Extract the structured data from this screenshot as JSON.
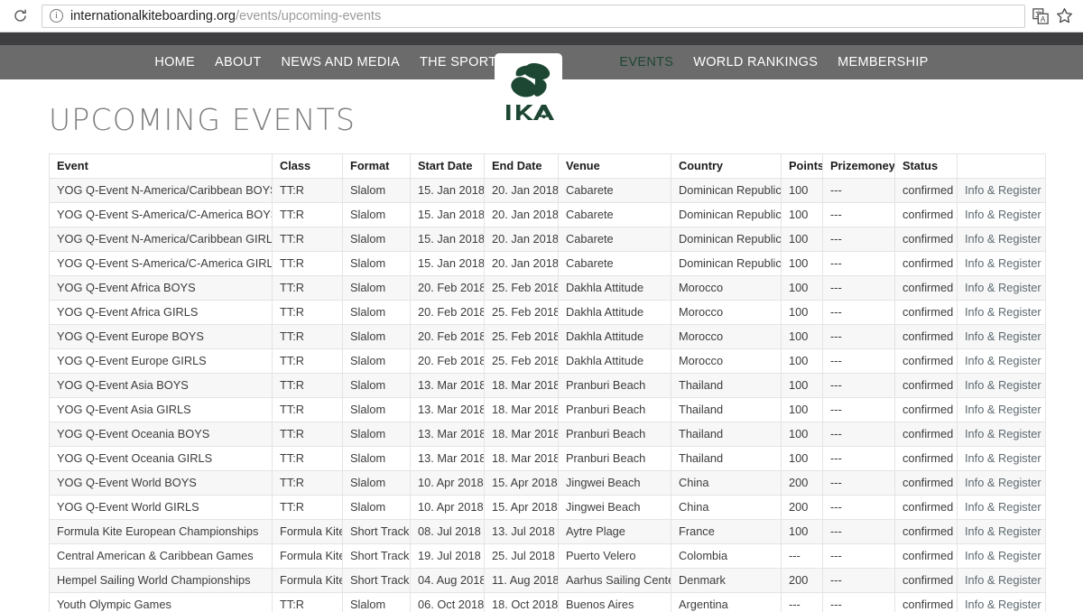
{
  "browser": {
    "reload_icon": "reload-icon",
    "info_icon": "info-icon",
    "info_glyph": "i",
    "url_host": "internationalkiteboarding.org",
    "url_path": "/events/upcoming-events",
    "translate_icon": "translate-icon",
    "star_icon": "star-bookmark-icon"
  },
  "nav": {
    "logo_text": "IKA",
    "active_color": "#1d4733",
    "left_items": [
      {
        "label": "HOME",
        "active": false
      },
      {
        "label": "ABOUT",
        "active": false
      },
      {
        "label": "NEWS AND MEDIA",
        "active": false
      },
      {
        "label": "THE SPORT",
        "active": false
      }
    ],
    "right_items": [
      {
        "label": "EVENTS",
        "active": true
      },
      {
        "label": "WORLD RANKINGS",
        "active": false
      },
      {
        "label": "MEMBERSHIP",
        "active": false
      }
    ]
  },
  "page": {
    "title": "UPCOMING EVENTS"
  },
  "table": {
    "headers": [
      "Event",
      "Class",
      "Format",
      "Start Date",
      "End Date",
      "Venue",
      "Country",
      "Points",
      "Prizemoney",
      "Status",
      ""
    ],
    "rows": [
      [
        "YOG Q-Event N-America/Caribbean BOYS",
        "TT:R",
        "Slalom",
        "15. Jan 2018",
        "20. Jan 2018",
        "Cabarete",
        "Dominican Republic",
        "100",
        "---",
        "confirmed",
        "Info & Register"
      ],
      [
        "YOG Q-Event S-America/C-America BOYS",
        "TT:R",
        "Slalom",
        "15. Jan 2018",
        "20. Jan 2018",
        "Cabarete",
        "Dominican Republic",
        "100",
        "---",
        "confirmed",
        "Info & Register"
      ],
      [
        "YOG Q-Event N-America/Caribbean GIRLS",
        "TT:R",
        "Slalom",
        "15. Jan 2018",
        "20. Jan 2018",
        "Cabarete",
        "Dominican Republic",
        "100",
        "---",
        "confirmed",
        "Info & Register"
      ],
      [
        "YOG Q-Event S-America/C-America GIRLS",
        "TT:R",
        "Slalom",
        "15. Jan 2018",
        "20. Jan 2018",
        "Cabarete",
        "Dominican Republic",
        "100",
        "---",
        "confirmed",
        "Info & Register"
      ],
      [
        "YOG Q-Event Africa BOYS",
        "TT:R",
        "Slalom",
        "20. Feb 2018",
        "25. Feb 2018",
        "Dakhla Attitude",
        "Morocco",
        "100",
        "---",
        "confirmed",
        "Info & Register"
      ],
      [
        "YOG Q-Event Africa GIRLS",
        "TT:R",
        "Slalom",
        "20. Feb 2018",
        "25. Feb 2018",
        "Dakhla Attitude",
        "Morocco",
        "100",
        "---",
        "confirmed",
        "Info & Register"
      ],
      [
        "YOG Q-Event Europe BOYS",
        "TT:R",
        "Slalom",
        "20. Feb 2018",
        "25. Feb 2018",
        "Dakhla Attitude",
        "Morocco",
        "100",
        "---",
        "confirmed",
        "Info & Register"
      ],
      [
        "YOG Q-Event Europe GIRLS",
        "TT:R",
        "Slalom",
        "20. Feb 2018",
        "25. Feb 2018",
        "Dakhla Attitude",
        "Morocco",
        "100",
        "---",
        "confirmed",
        "Info & Register"
      ],
      [
        "YOG Q-Event Asia BOYS",
        "TT:R",
        "Slalom",
        "13. Mar 2018",
        "18. Mar 2018",
        "Pranburi Beach",
        "Thailand",
        "100",
        "---",
        "confirmed",
        "Info & Register"
      ],
      [
        "YOG Q-Event Asia GIRLS",
        "TT:R",
        "Slalom",
        "13. Mar 2018",
        "18. Mar 2018",
        "Pranburi Beach",
        "Thailand",
        "100",
        "---",
        "confirmed",
        "Info & Register"
      ],
      [
        "YOG Q-Event Oceania BOYS",
        "TT:R",
        "Slalom",
        "13. Mar 2018",
        "18. Mar 2018",
        "Pranburi Beach",
        "Thailand",
        "100",
        "---",
        "confirmed",
        "Info & Register"
      ],
      [
        "YOG Q-Event Oceania GIRLS",
        "TT:R",
        "Slalom",
        "13. Mar 2018",
        "18. Mar 2018",
        "Pranburi Beach",
        "Thailand",
        "100",
        "---",
        "confirmed",
        "Info & Register"
      ],
      [
        "YOG Q-Event World BOYS",
        "TT:R",
        "Slalom",
        "10. Apr 2018",
        "15. Apr 2018",
        "Jingwei Beach",
        "China",
        "200",
        "---",
        "confirmed",
        "Info & Register"
      ],
      [
        "YOG Q-Event World GIRLS",
        "TT:R",
        "Slalom",
        "10. Apr 2018",
        "15. Apr 2018",
        "Jingwei Beach",
        "China",
        "200",
        "---",
        "confirmed",
        "Info & Register"
      ],
      [
        "Formula Kite European Championships",
        "Formula Kite",
        "Short Track",
        "08. Jul 2018",
        "13. Jul 2018",
        "Aytre Plage",
        "France",
        "100",
        "---",
        "confirmed",
        "Info & Register"
      ],
      [
        "Central American & Caribbean Games",
        "Formula Kite",
        "Short Track",
        "19. Jul 2018",
        "25. Jul 2018",
        "Puerto Velero",
        "Colombia",
        "---",
        "---",
        "confirmed",
        "Info & Register"
      ],
      [
        "Hempel Sailing World Championships",
        "Formula Kite",
        "Short Track",
        "04. Aug 2018",
        "11. Aug 2018",
        "Aarhus Sailing Center",
        "Denmark",
        "200",
        "---",
        "confirmed",
        "Info & Register"
      ],
      [
        "Youth Olympic Games",
        "TT:R",
        "Slalom",
        "06. Oct 2018",
        "18. Oct 2018",
        "Buenos Aires",
        "Argentina",
        "---",
        "---",
        "confirmed",
        "Info & Register"
      ]
    ]
  }
}
